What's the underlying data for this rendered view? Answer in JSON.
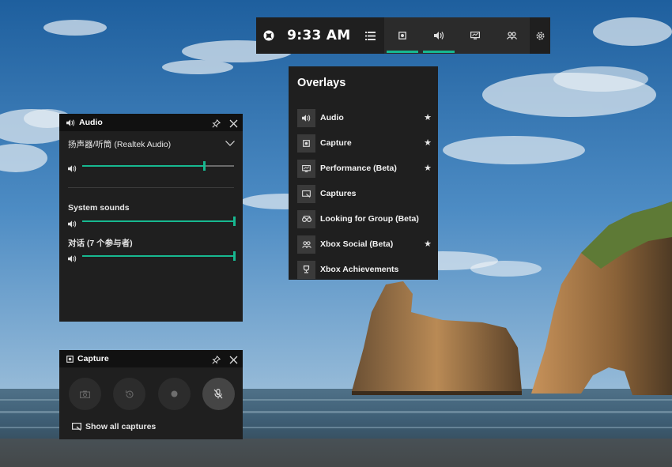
{
  "gamebar": {
    "time": "9:33 AM",
    "widgets": [
      {
        "name": "capture",
        "icon": "capture-icon",
        "active": true
      },
      {
        "name": "audio",
        "icon": "audio-icon",
        "active": true
      },
      {
        "name": "performance",
        "icon": "performance-icon",
        "active": false
      },
      {
        "name": "social",
        "icon": "social-icon",
        "active": false
      }
    ],
    "accent_color": "#17b890"
  },
  "overlays": {
    "title": "Overlays",
    "items": [
      {
        "label": "Audio",
        "icon": "audio-icon",
        "favorite": true,
        "star": "★"
      },
      {
        "label": "Capture",
        "icon": "capture-icon",
        "favorite": true,
        "star": "★"
      },
      {
        "label": "Performance (Beta)",
        "icon": "performance-icon",
        "favorite": true,
        "star": "★"
      },
      {
        "label": "Captures",
        "icon": "captures-gallery-icon",
        "favorite": false,
        "star": ""
      },
      {
        "label": "Looking for Group (Beta)",
        "icon": "binoculars-icon",
        "favorite": false,
        "star": ""
      },
      {
        "label": "Xbox Social (Beta)",
        "icon": "social-icon",
        "favorite": true,
        "star": "★"
      },
      {
        "label": "Xbox Achievements",
        "icon": "trophy-icon",
        "favorite": false,
        "star": ""
      }
    ]
  },
  "audio": {
    "title": "Audio",
    "device": "扬声器/听筒 (Realtek Audio)",
    "device_volume": 0.8,
    "mix": [
      {
        "label": "System sounds",
        "volume": 1.0
      },
      {
        "label": "对话 (7 个参与者)",
        "volume": 1.0
      }
    ]
  },
  "capture": {
    "title": "Capture",
    "buttons": [
      {
        "name": "screenshot",
        "icon": "camera-icon"
      },
      {
        "name": "record-last",
        "icon": "record-last-icon"
      },
      {
        "name": "record",
        "icon": "record-dot-icon"
      },
      {
        "name": "mic",
        "icon": "mic-off-icon"
      }
    ],
    "show_all_label": "Show all captures"
  }
}
